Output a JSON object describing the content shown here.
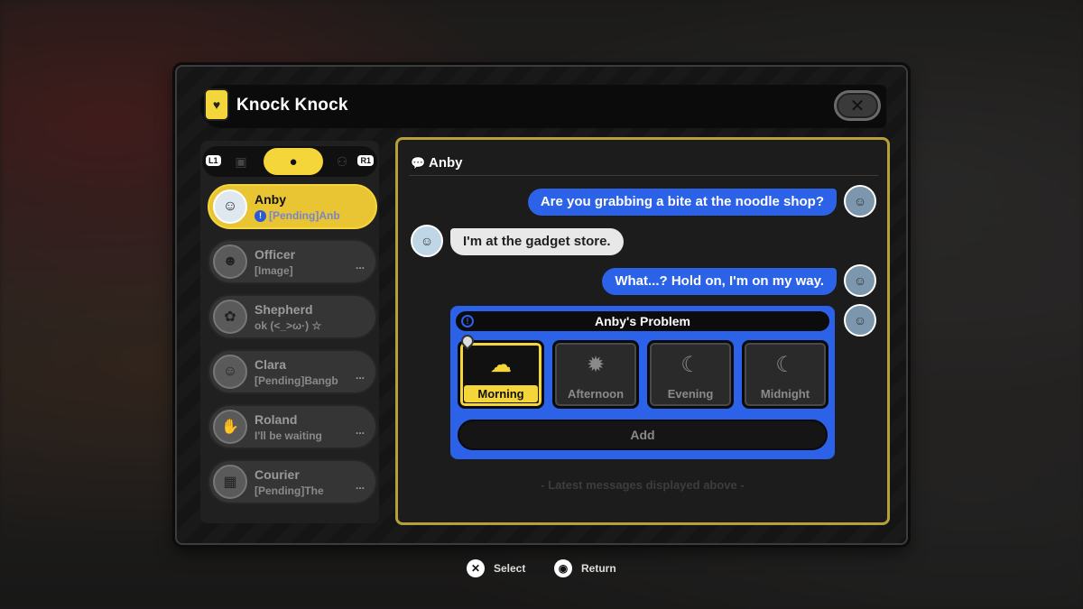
{
  "app": {
    "title": "Knock Knock"
  },
  "tabs": {
    "left_key": "L1",
    "right_key": "R1"
  },
  "contacts": [
    {
      "name": "Anby",
      "preview": "[Pending]Anb",
      "pending": true,
      "active": true
    },
    {
      "name": "Officer",
      "preview": "[Image]",
      "more": "..."
    },
    {
      "name": "Shepherd",
      "preview": "ok (<_>ω·) ☆"
    },
    {
      "name": "Clara",
      "preview": "[Pending]Bangb",
      "more": "..."
    },
    {
      "name": "Roland",
      "preview": "I'll be waiting",
      "more": "..."
    },
    {
      "name": "Courier",
      "preview": "[Pending]The",
      "more": "..."
    }
  ],
  "chat": {
    "contact_name": "Anby",
    "messages": [
      {
        "from": "self",
        "text": "Are you grabbing a bite at the noodle shop?"
      },
      {
        "from": "other",
        "text": "I'm at the gadget store."
      },
      {
        "from": "self",
        "text": "What...? Hold on, I'm on my way."
      }
    ],
    "problem": {
      "title": "Anby's Problem",
      "options": [
        {
          "label": "Morning",
          "icon": "sun-cloud-icon",
          "selected": true
        },
        {
          "label": "Afternoon",
          "icon": "sun-icon"
        },
        {
          "label": "Evening",
          "icon": "moon-icon"
        },
        {
          "label": "Midnight",
          "icon": "moon-cloud-icon"
        }
      ],
      "add_label": "Add"
    },
    "latest_note": "- Latest messages displayed above -"
  },
  "footer": {
    "select_label": "Select",
    "return_label": "Return"
  },
  "colors": {
    "accent_yellow": "#f5d63a",
    "bubble_blue": "#2c62e8"
  }
}
